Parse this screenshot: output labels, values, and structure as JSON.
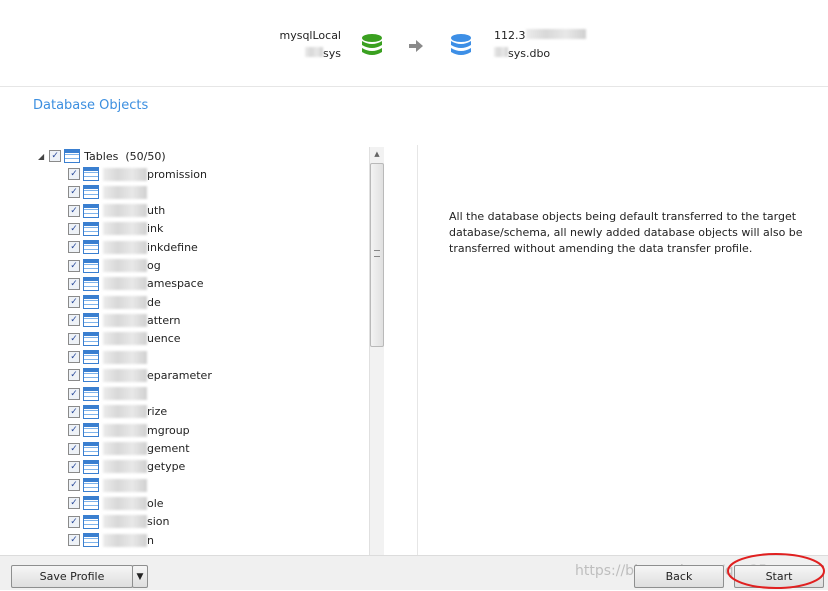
{
  "header": {
    "source": {
      "connection": "mysqlLocal",
      "database": "sys",
      "icon": "database-icon",
      "color": "#3aa020"
    },
    "arrow": "arrow-right-icon",
    "target": {
      "connection": "112.3",
      "database": "sys.dbo",
      "icon": "database-icon",
      "color": "#3d8fe6"
    }
  },
  "section_title": "Database Objects",
  "tree": {
    "root": {
      "label": "Tables",
      "count": "(50/50)",
      "checked": "partial"
    },
    "items": [
      "promission",
      "",
      "uth",
      "ink",
      "inkdefine",
      "og",
      "amespace",
      "de",
      "attern",
      "uence",
      "",
      "eparameter",
      "",
      "rize",
      "mgroup",
      "gement",
      "getype",
      "",
      "ole",
      "sion",
      "n"
    ]
  },
  "description": "All the database objects being default transferred to the target database/schema, all newly added database objects will also be transferred without amending the data transfer profile.",
  "footer": {
    "save_profile": "Save Profile",
    "back": "Back",
    "start": "Start",
    "watermark": "https://blog.csdn.net/qq_35..."
  }
}
